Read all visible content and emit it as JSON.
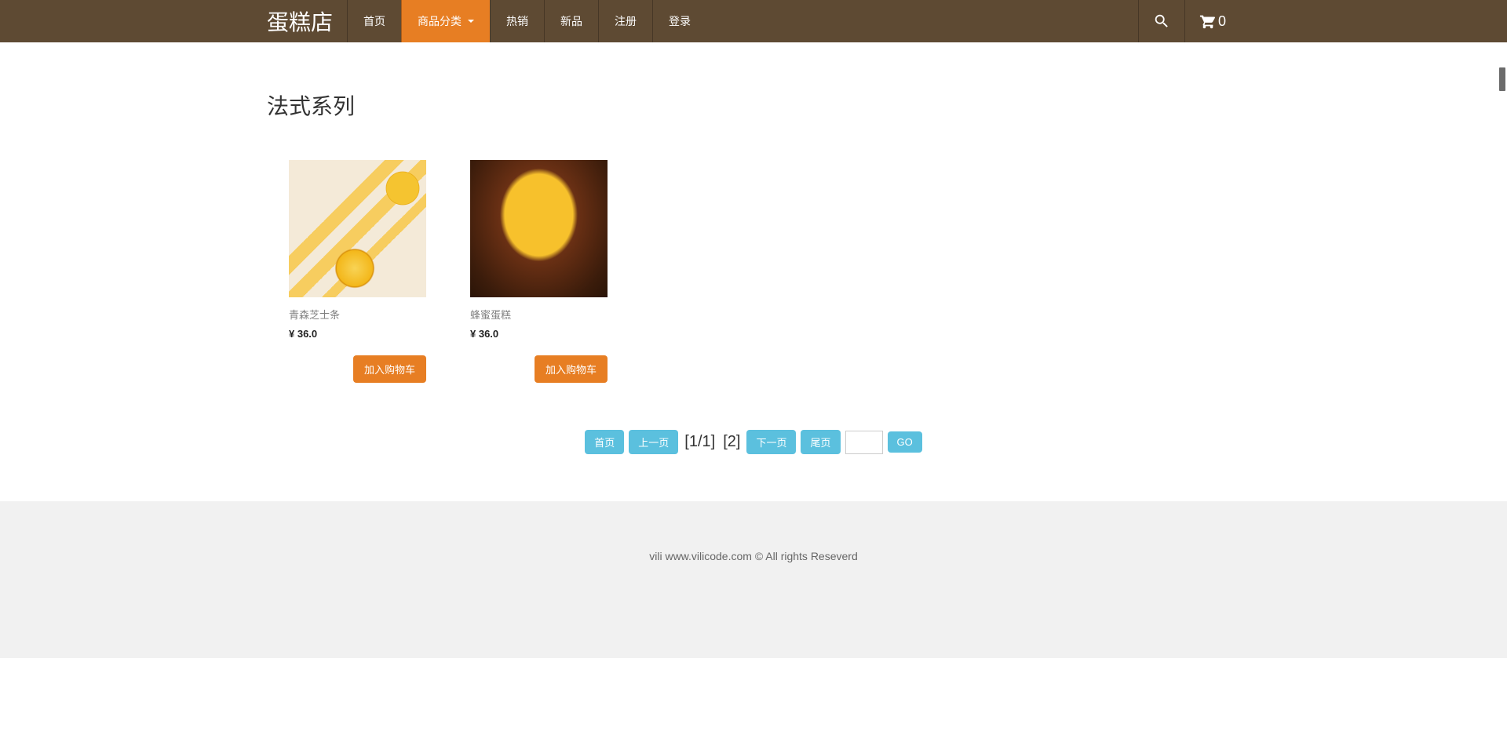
{
  "header": {
    "brand": "蛋糕店",
    "nav": {
      "home": "首页",
      "categories": "商品分类",
      "hot": "热销",
      "new": "新品",
      "register": "注册",
      "login": "登录"
    },
    "cart_count": "0"
  },
  "page": {
    "title": "法式系列"
  },
  "products": [
    {
      "name": "青森芝士条",
      "price": "¥ 36.0",
      "add_label": "加入购物车"
    },
    {
      "name": "蜂蜜蛋糕",
      "price": "¥ 36.0",
      "add_label": "加入购物车"
    }
  ],
  "pagination": {
    "first": "首页",
    "prev": "上一页",
    "info": "[1/1]",
    "total": "[2]",
    "next": "下一页",
    "last": "尾页",
    "go": "GO"
  },
  "footer": {
    "text": "vili www.vilicode.com © All rights Reseverd"
  }
}
